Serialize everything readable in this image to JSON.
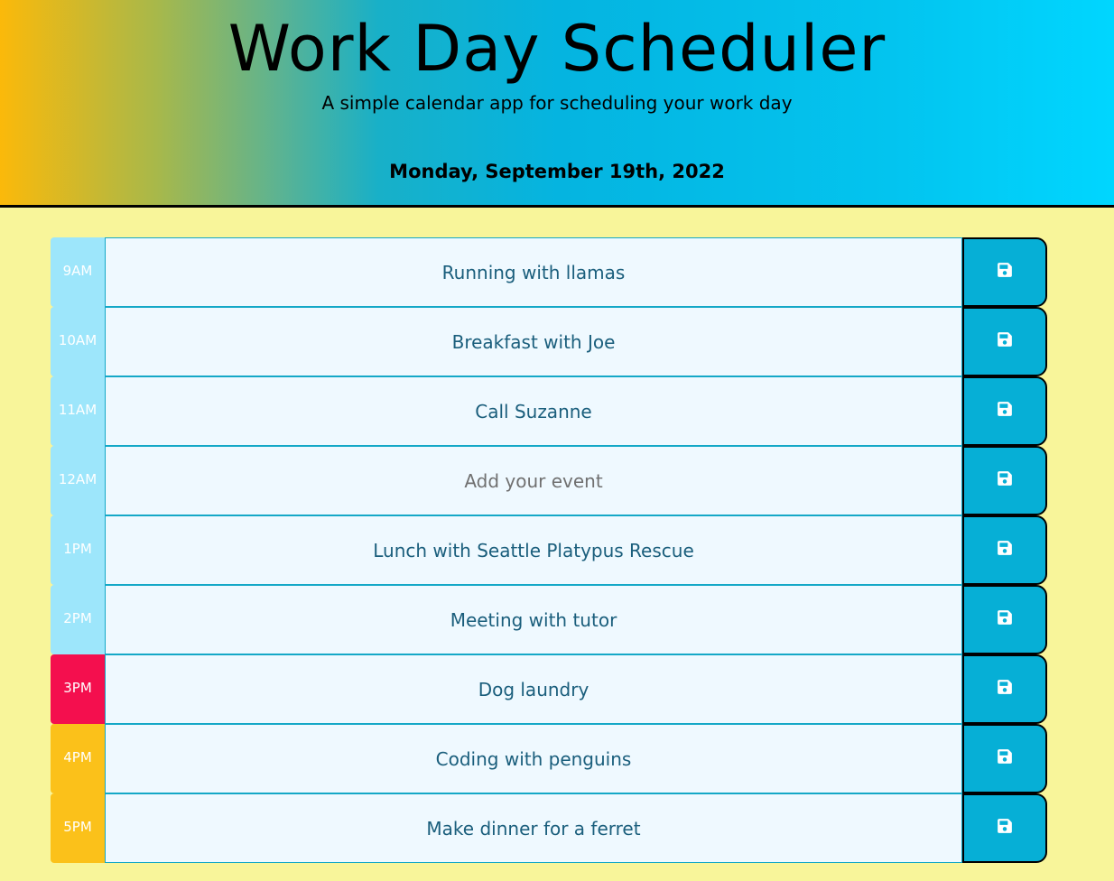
{
  "header": {
    "title": "Work Day Scheduler",
    "subtitle": "A simple calendar app for scheduling your work day",
    "date": "Monday, September 19th, 2022"
  },
  "colors": {
    "past": "#9de6fb",
    "present": "#f40f4e",
    "future": "#fbc11a",
    "save_button": "#06afd6",
    "page_background": "#f8f59a"
  },
  "rows": [
    {
      "hour": "9AM",
      "state": "past",
      "text": "Running with llamas",
      "placeholder": "Add your event",
      "save_icon": "save-icon"
    },
    {
      "hour": "10AM",
      "state": "past",
      "text": "Breakfast with Joe",
      "placeholder": "Add your event",
      "save_icon": "save-icon"
    },
    {
      "hour": "11AM",
      "state": "past",
      "text": "Call Suzanne",
      "placeholder": "Add your event",
      "save_icon": "save-icon"
    },
    {
      "hour": "12AM",
      "state": "past",
      "text": "",
      "placeholder": "Add your event",
      "save_icon": "save-icon"
    },
    {
      "hour": "1PM",
      "state": "past",
      "text": "Lunch with Seattle Platypus Rescue",
      "placeholder": "Add your event",
      "save_icon": "save-icon"
    },
    {
      "hour": "2PM",
      "state": "past",
      "text": "Meeting with tutor",
      "placeholder": "Add your event",
      "save_icon": "save-icon"
    },
    {
      "hour": "3PM",
      "state": "present",
      "text": "Dog laundry",
      "placeholder": "Add your event",
      "save_icon": "save-icon"
    },
    {
      "hour": "4PM",
      "state": "future",
      "text": "Coding with penguins",
      "placeholder": "Add your event",
      "save_icon": "save-icon"
    },
    {
      "hour": "5PM",
      "state": "future",
      "text": "Make dinner for a ferret",
      "placeholder": "Add your event",
      "save_icon": "save-icon"
    }
  ]
}
